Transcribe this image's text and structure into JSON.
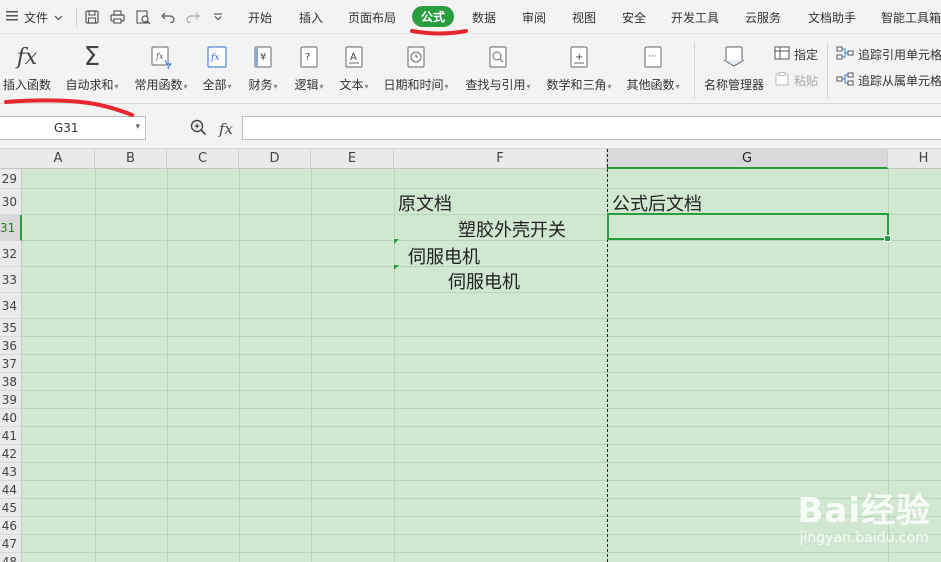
{
  "menubar": {
    "file_label": "文件",
    "tabs": [
      {
        "label": "开始"
      },
      {
        "label": "插入"
      },
      {
        "label": "页面布局"
      },
      {
        "label": "公式",
        "active": true
      },
      {
        "label": "数据"
      },
      {
        "label": "审阅"
      },
      {
        "label": "视图"
      },
      {
        "label": "安全"
      },
      {
        "label": "开发工具"
      },
      {
        "label": "云服务"
      },
      {
        "label": "文档助手"
      },
      {
        "label": "智能工具箱"
      }
    ],
    "quick_access_icons": [
      "save-icon",
      "print-icon",
      "print-preview-icon",
      "undo-icon",
      "redo-icon",
      "customize-dropdown-icon"
    ]
  },
  "ribbon": {
    "buttons": [
      {
        "label": "插入函数",
        "icon": "fx-icon"
      },
      {
        "label": "自动求和",
        "icon": "sigma-icon",
        "dropdown": true
      },
      {
        "label": "常用函数",
        "icon": "common-functions-icon",
        "dropdown": true
      },
      {
        "label": "全部",
        "icon": "all-functions-icon",
        "dropdown": true
      },
      {
        "label": "财务",
        "icon": "finance-icon",
        "dropdown": true
      },
      {
        "label": "逻辑",
        "icon": "logic-icon",
        "dropdown": true
      },
      {
        "label": "文本",
        "icon": "text-icon",
        "dropdown": true
      },
      {
        "label": "日期和时间",
        "icon": "datetime-icon",
        "dropdown": true
      },
      {
        "label": "查找与引用",
        "icon": "lookup-icon",
        "dropdown": true
      },
      {
        "label": "数学和三角",
        "icon": "math-icon",
        "dropdown": true
      },
      {
        "label": "其他函数",
        "icon": "other-functions-icon",
        "dropdown": true
      },
      {
        "label": "名称管理器",
        "icon": "name-manager-icon"
      }
    ],
    "small_buttons": [
      {
        "label": "指定",
        "icon": "specify-icon",
        "disabled": false
      },
      {
        "label": "粘贴",
        "icon": "paste-icon",
        "disabled": true
      },
      {
        "label": "追踪引用单元格",
        "icon": "trace-precedents-icon",
        "disabled": false
      },
      {
        "label": "追踪从属单元格",
        "icon": "trace-dependents-icon",
        "disabled": false
      }
    ]
  },
  "formula_bar": {
    "name_box": "G31",
    "fx_label": "fx",
    "formula_value": ""
  },
  "sheet": {
    "columns": [
      "A",
      "B",
      "C",
      "D",
      "E",
      "F",
      "G",
      "H"
    ],
    "selected_column": "G",
    "rows": [
      "29",
      "30",
      "31",
      "32",
      "33",
      "34",
      "35",
      "36",
      "37",
      "38",
      "39",
      "40",
      "41",
      "42",
      "43",
      "44",
      "45",
      "46",
      "47",
      "48"
    ],
    "selected_row": "31",
    "cells": {
      "F30": "原文档",
      "G30": "公式后文档",
      "F31": "塑胶外壳开关",
      "F32": "伺服电机",
      "F33": "伺服电机"
    },
    "colors": {
      "accent": "#2a9d3f",
      "sheet_bg": "#cfe8cf",
      "annotation": "#e8262d"
    }
  },
  "watermark": {
    "brand": "Bai经验",
    "url": "jingyan.baidu.com"
  }
}
